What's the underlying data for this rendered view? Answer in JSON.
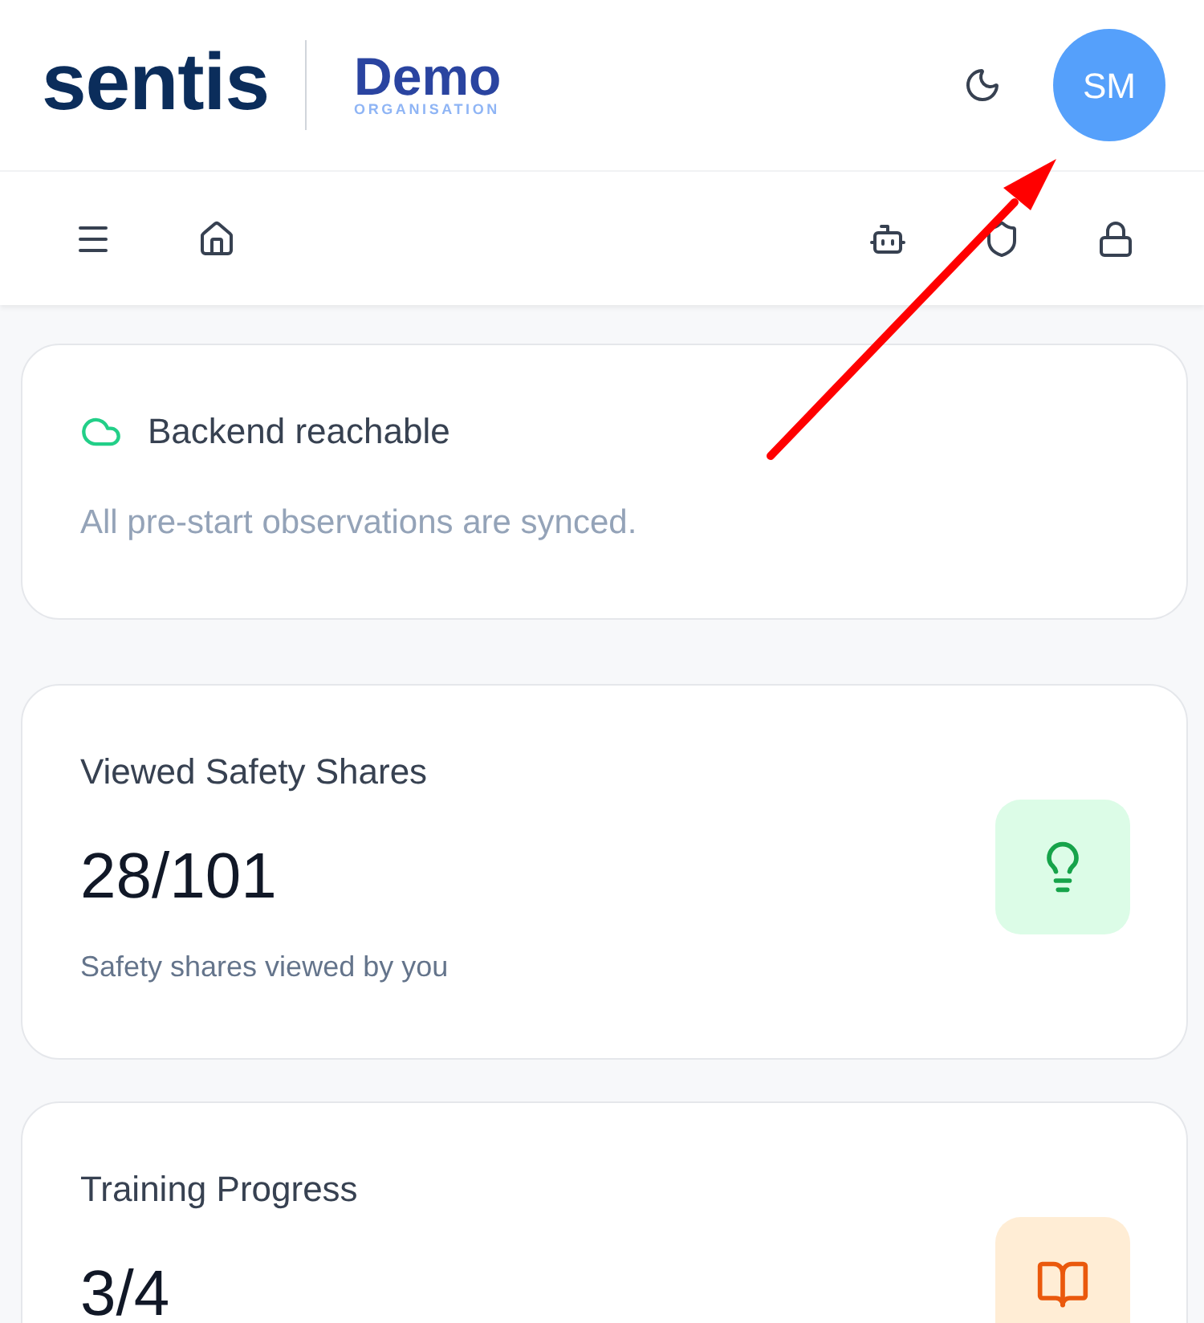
{
  "header": {
    "logo": "sentis",
    "organisation": {
      "name": "Demo",
      "label": "ORGANISATION"
    },
    "avatar": {
      "initials": "SM"
    }
  },
  "status_card": {
    "title": "Backend reachable",
    "message": "All pre-start observations are synced."
  },
  "stat_cards": [
    {
      "kind": "lightbulb",
      "title": "Viewed Safety Shares",
      "value": "28/101",
      "caption": "Safety shares viewed by you"
    },
    {
      "kind": "book",
      "title": "Training Progress",
      "value": "3/4"
    }
  ]
}
